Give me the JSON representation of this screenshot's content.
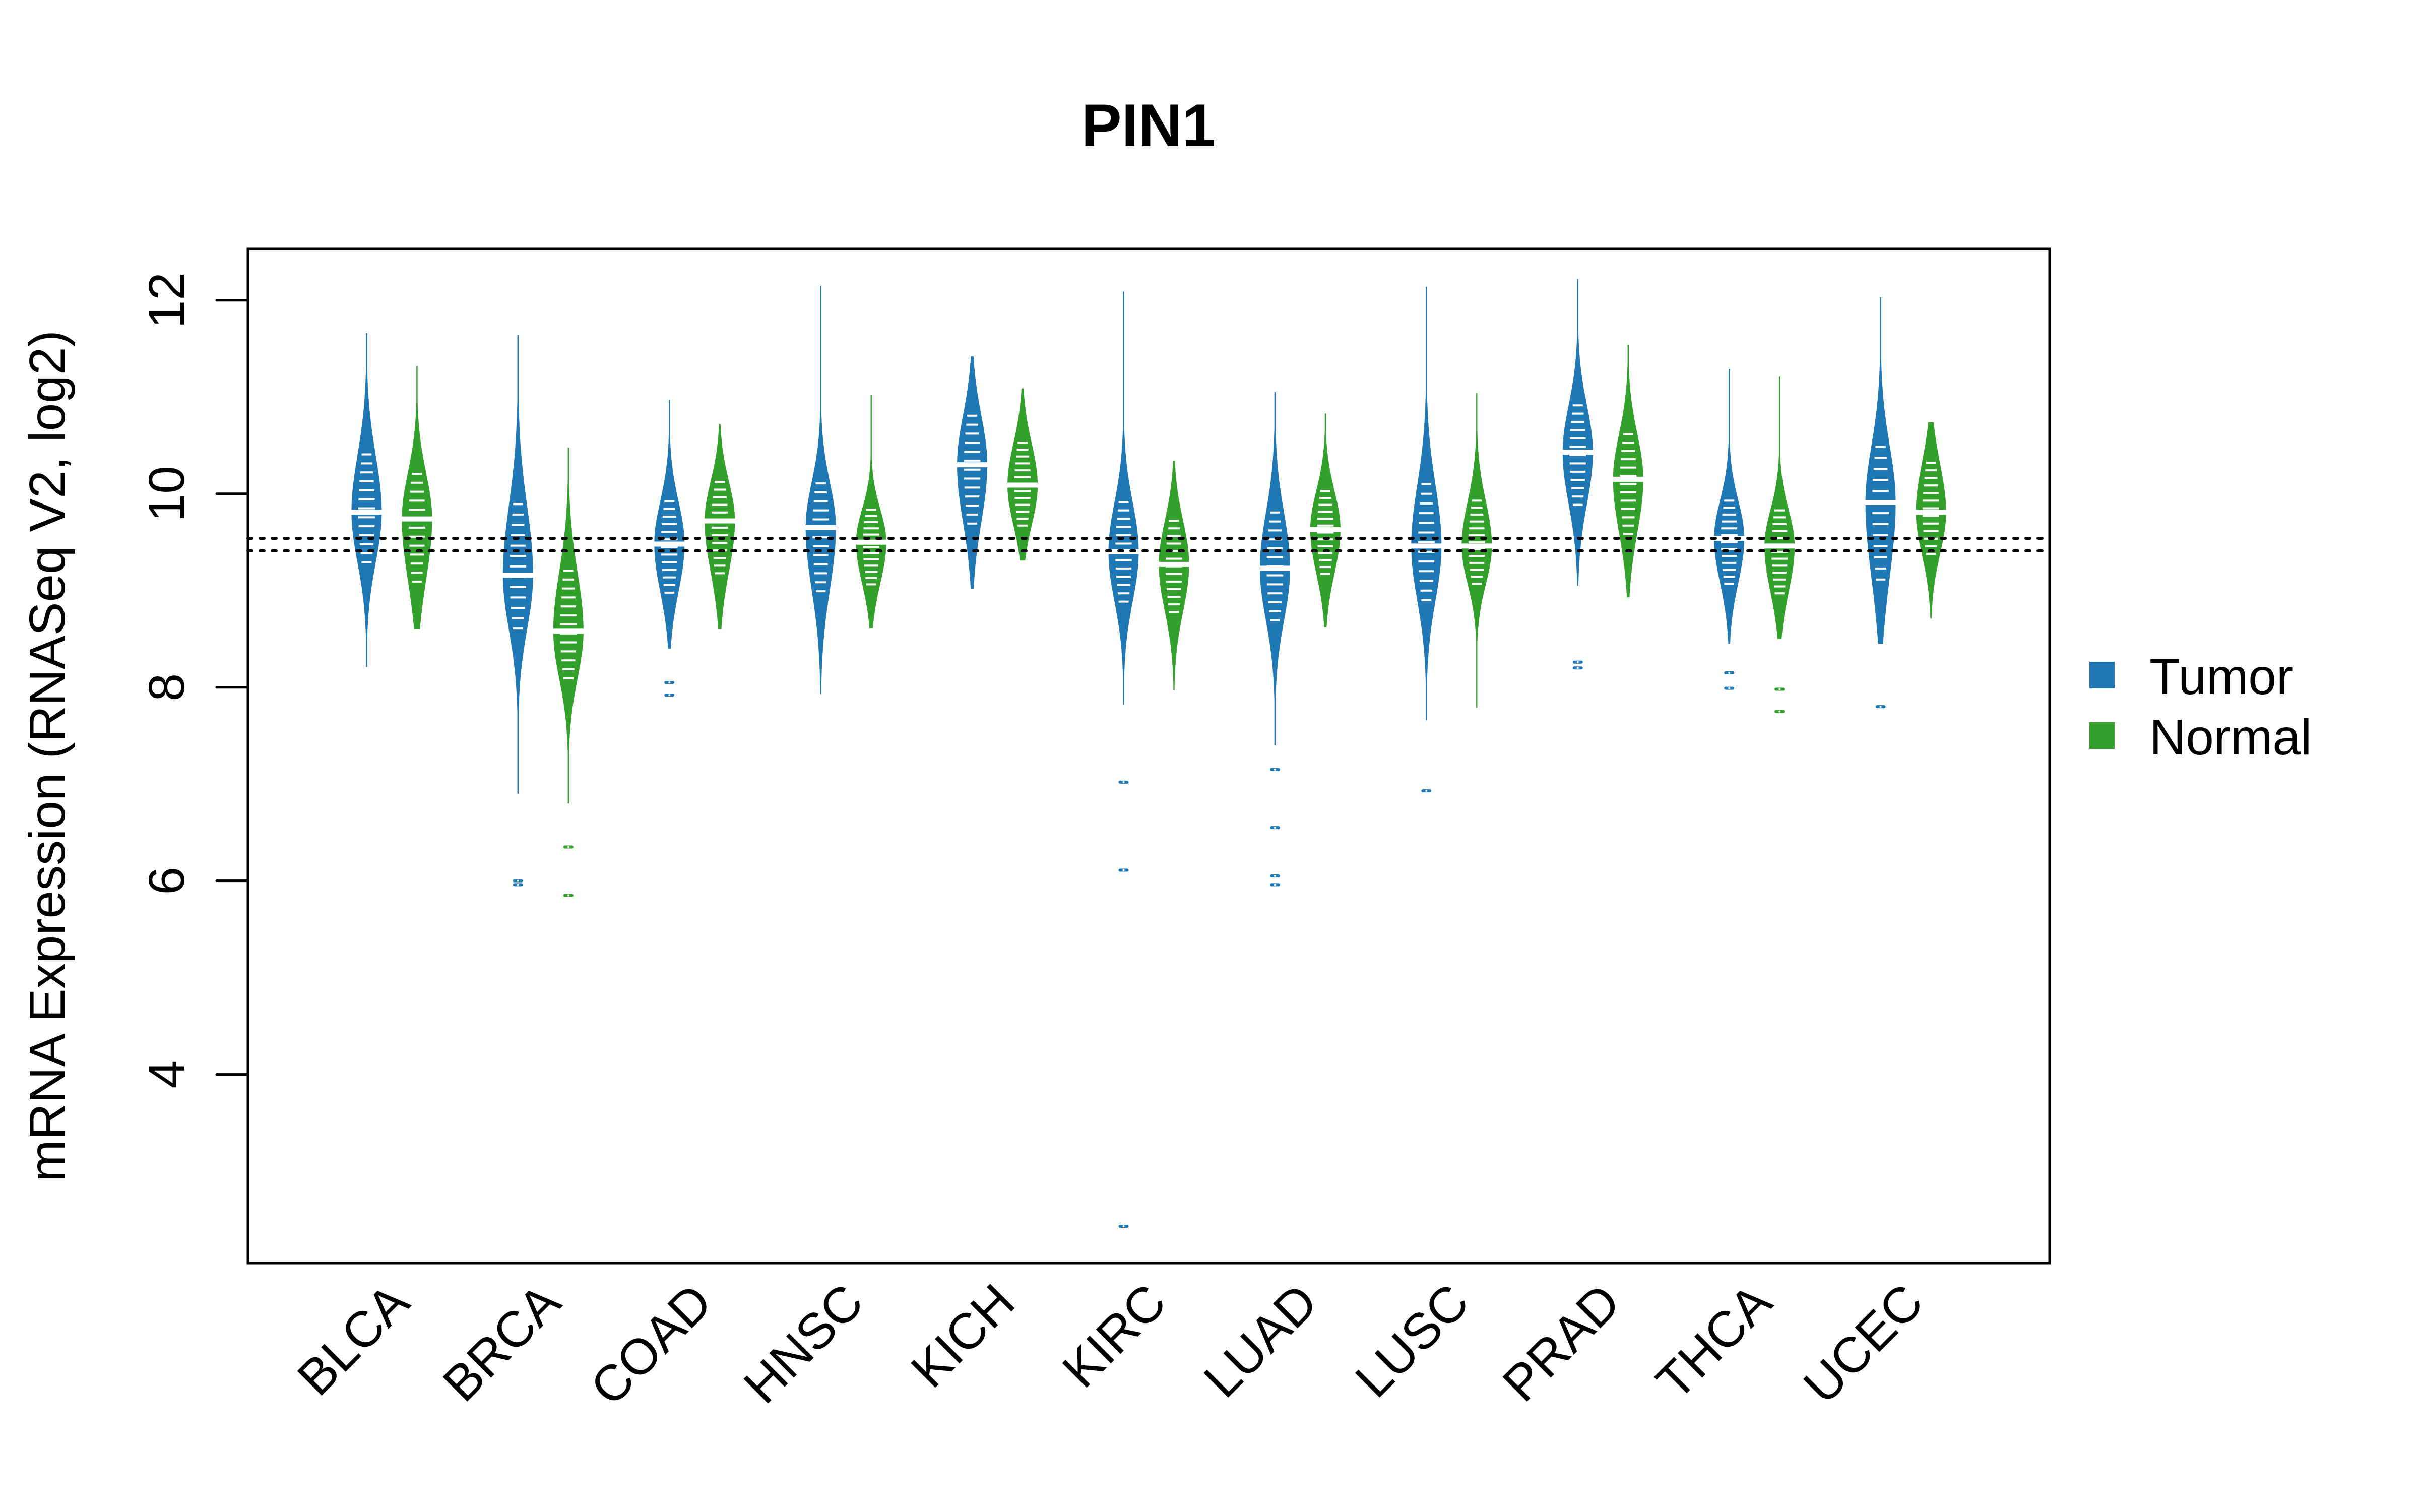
{
  "chart_data": {
    "type": "violin",
    "title": "PIN1",
    "xlabel": "",
    "ylabel": "mRNA Expression (RNASeq V2, log2)",
    "ylim": [
      2.05,
      12.53
    ],
    "yticks": [
      4,
      6,
      8,
      10,
      12
    ],
    "grid": false,
    "legend": {
      "placement": "right",
      "entries": [
        {
          "name": "Tumor",
          "color": "#1f77b4"
        },
        {
          "name": "Normal",
          "color": "#33a02c"
        }
      ]
    },
    "reference_lines": [
      9.54,
      9.41
    ],
    "categories": [
      "BLCA",
      "BRCA",
      "COAD",
      "HNSC",
      "KICH",
      "KIRC",
      "LUAD",
      "LUSC",
      "PRAD",
      "THCA",
      "UCEC"
    ],
    "series": [
      {
        "name": "Tumor",
        "color": "#1f77b4",
        "values": [
          {
            "min": 8.21,
            "body_low": 9.2,
            "median": 9.81,
            "body_high": 10.5,
            "max": 11.66,
            "outliers": []
          },
          {
            "min": 6.9,
            "body_low": 8.5,
            "median": 9.16,
            "body_high": 10.0,
            "max": 11.64,
            "outliers": [
              6.0,
              5.96
            ]
          },
          {
            "min": 8.4,
            "body_low": 8.9,
            "median": 9.48,
            "body_high": 10.0,
            "max": 10.97,
            "outliers": [
              8.05,
              7.92
            ]
          },
          {
            "min": 7.93,
            "body_low": 8.9,
            "median": 9.65,
            "body_high": 10.2,
            "max": 12.15,
            "outliers": []
          },
          {
            "min": 9.02,
            "body_low": 9.6,
            "median": 10.3,
            "body_high": 10.9,
            "max": 11.42,
            "outliers": []
          },
          {
            "min": 7.82,
            "body_low": 8.8,
            "median": 9.4,
            "body_high": 10.0,
            "max": 12.09,
            "outliers": [
              7.02,
              6.11,
              2.43
            ]
          },
          {
            "min": 7.4,
            "body_low": 8.6,
            "median": 9.23,
            "body_high": 9.9,
            "max": 11.05,
            "outliers": [
              7.15,
              6.55,
              6.05,
              5.96
            ]
          },
          {
            "min": 7.66,
            "body_low": 8.8,
            "median": 9.46,
            "body_high": 10.2,
            "max": 12.14,
            "outliers": [
              6.93
            ]
          },
          {
            "min": 9.05,
            "body_low": 9.8,
            "median": 10.43,
            "body_high": 11.0,
            "max": 12.22,
            "outliers": [
              8.26,
              8.2
            ]
          },
          {
            "min": 8.45,
            "body_low": 9.0,
            "median": 9.54,
            "body_high": 10.0,
            "max": 11.29,
            "outliers": [
              8.15,
              7.99
            ]
          },
          {
            "min": 8.45,
            "body_low": 9.0,
            "median": 9.91,
            "body_high": 10.6,
            "max": 12.03,
            "outliers": [
              7.8
            ]
          }
        ]
      },
      {
        "name": "Normal",
        "color": "#33a02c",
        "values": [
          {
            "min": 8.6,
            "body_low": 9.0,
            "median": 9.74,
            "body_high": 10.3,
            "max": 11.32,
            "outliers": []
          },
          {
            "min": 6.8,
            "body_low": 8.0,
            "median": 8.58,
            "body_high": 9.3,
            "max": 10.48,
            "outliers": [
              6.35,
              5.85
            ]
          },
          {
            "min": 8.6,
            "body_low": 9.1,
            "median": 9.72,
            "body_high": 10.2,
            "max": 10.72,
            "outliers": []
          },
          {
            "min": 8.61,
            "body_low": 9.0,
            "median": 9.5,
            "body_high": 9.9,
            "max": 11.02,
            "outliers": []
          },
          {
            "min": 9.31,
            "body_low": 9.6,
            "median": 10.09,
            "body_high": 10.6,
            "max": 11.09,
            "outliers": []
          },
          {
            "min": 7.97,
            "body_low": 8.7,
            "median": 9.27,
            "body_high": 9.8,
            "max": 10.34,
            "outliers": []
          },
          {
            "min": 8.62,
            "body_low": 9.1,
            "median": 9.63,
            "body_high": 10.1,
            "max": 10.83,
            "outliers": []
          },
          {
            "min": 7.79,
            "body_low": 9.0,
            "median": 9.46,
            "body_high": 10.0,
            "max": 11.04,
            "outliers": []
          },
          {
            "min": 8.93,
            "body_low": 9.5,
            "median": 10.15,
            "body_high": 10.7,
            "max": 11.54,
            "outliers": []
          },
          {
            "min": 8.5,
            "body_low": 8.9,
            "median": 9.46,
            "body_high": 9.9,
            "max": 11.21,
            "outliers": [
              7.98,
              7.75
            ]
          },
          {
            "min": 8.71,
            "body_low": 9.3,
            "median": 9.81,
            "body_high": 10.4,
            "max": 10.74,
            "outliers": []
          }
        ]
      }
    ]
  }
}
